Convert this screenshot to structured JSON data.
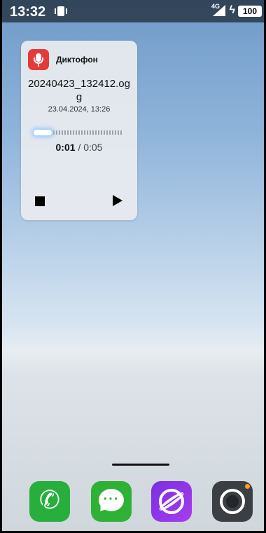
{
  "status_bar": {
    "time": "13:32",
    "network_type": "4G",
    "battery": "100"
  },
  "widget": {
    "app_name": "Диктофон",
    "file_name": "20240423_132412.ogg",
    "date": "23.04.2024, 13:26",
    "position": "0:01",
    "separator": "/",
    "duration": "0:05",
    "progress": 0.2
  },
  "dock": {
    "apps": [
      "phone",
      "messages",
      "browser",
      "camera"
    ]
  },
  "colors": {
    "recorder_icon": "#e53a3a",
    "phone": "#27ae3d",
    "messages": "#2eb135",
    "browser": "#8a35e8",
    "camera": "#3b3f44"
  }
}
